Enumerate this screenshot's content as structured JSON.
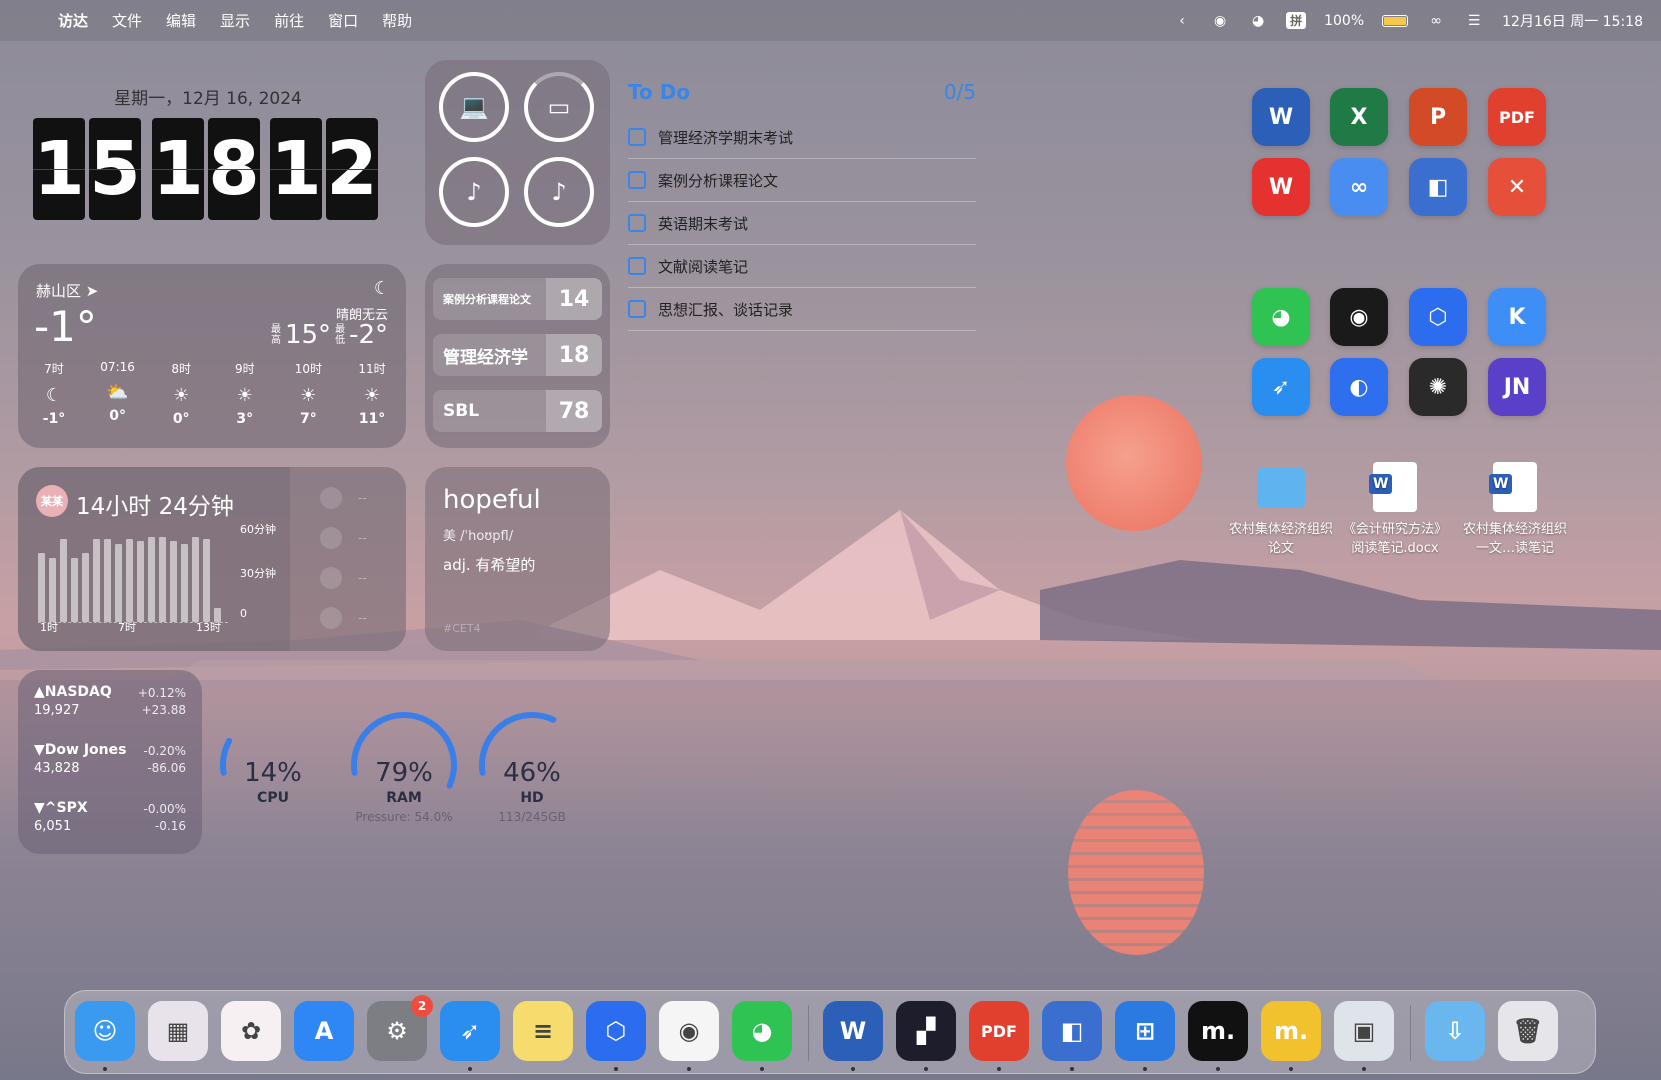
{
  "menubar": {
    "apple": "",
    "items": [
      "访达",
      "文件",
      "编辑",
      "显示",
      "前往",
      "窗口",
      "帮助"
    ],
    "status": {
      "ime": "拼",
      "battery": "100%",
      "datetime": "12月16日 周一 15:18"
    }
  },
  "clock": {
    "date": "星期一，12月 16, 2024",
    "digits": [
      "1",
      "5",
      "1",
      "8",
      "1",
      "2"
    ]
  },
  "weather": {
    "location": "赫山区",
    "temp": "-1°",
    "condition": "晴朗无云",
    "high_label": "最高",
    "high": "15°",
    "low_label": "最低",
    "low": "-2°",
    "hours": [
      {
        "time": "7时",
        "icon": "moon-icon",
        "glyph": "☾",
        "temp": "-1°"
      },
      {
        "time": "07:16",
        "icon": "sunrise-icon",
        "glyph": "⛅",
        "temp": "0°"
      },
      {
        "time": "8时",
        "icon": "sun-icon",
        "glyph": "☀",
        "temp": "0°"
      },
      {
        "time": "9时",
        "icon": "sun-icon",
        "glyph": "☀",
        "temp": "3°"
      },
      {
        "time": "10时",
        "icon": "sun-icon",
        "glyph": "☀",
        "temp": "7°"
      },
      {
        "time": "11时",
        "icon": "sun-icon",
        "glyph": "☀",
        "temp": "11°"
      }
    ]
  },
  "countdown": {
    "items": [
      {
        "name": "案例分析课程论文",
        "days": "14"
      },
      {
        "name": "管理经济学",
        "days": "18"
      },
      {
        "name": "SBL",
        "days": "78"
      }
    ]
  },
  "todo": {
    "title": "To Do",
    "count": "0/5",
    "items": [
      "管理经济学期末考试",
      "案例分析课程论文",
      "英语期末考试",
      "文献阅读笔记",
      "思想汇报、谈话记录"
    ]
  },
  "screentime": {
    "avatar": "某某",
    "total": "14小时 24分钟",
    "y_labels": [
      "60分钟",
      "30分钟",
      "0"
    ],
    "x_labels": [
      "1时",
      "7时",
      "13时"
    ],
    "bars": [
      0.75,
      0.7,
      0.9,
      0.7,
      0.75,
      0.9,
      0.9,
      0.85,
      0.9,
      0.88,
      0.92,
      0.92,
      0.88,
      0.85,
      0.92,
      0.9,
      0.15
    ],
    "right_dashes": [
      "--",
      "--",
      "--",
      "--"
    ]
  },
  "dictionary": {
    "word": "hopeful",
    "phonetic": "美  /ˈhoʊpfl/",
    "definition": "adj. 有希望的",
    "tag": "#CET4"
  },
  "stocks": [
    {
      "name": "▲NASDAQ",
      "price": "19,927",
      "pct": "+0.12%",
      "chg": "+23.88"
    },
    {
      "name": "▼Dow Jones",
      "price": "43,828",
      "pct": "-0.20%",
      "chg": "-86.06"
    },
    {
      "name": "▼^SPX",
      "price": "6,051",
      "pct": "-0.00%",
      "chg": "-0.16"
    }
  ],
  "system": {
    "cpu": {
      "value": "14%",
      "label": "CPU",
      "fraction": 0.14
    },
    "ram": {
      "value": "79%",
      "label": "RAM",
      "sub": "Pressure: 54.0%",
      "fraction": 0.79
    },
    "hd": {
      "value": "46%",
      "label": "HD",
      "sub": "113/245GB",
      "fraction": 0.46
    }
  },
  "desktop": {
    "docs": [
      {
        "icon": "folder-icon",
        "label": "农村集体经济组织论文"
      },
      {
        "icon": "word-doc-icon",
        "label": "《会计研究方法》阅读笔记.docx"
      },
      {
        "icon": "word-doc-icon",
        "label": "农村集体经济组织一文…读笔记"
      }
    ],
    "apps": [
      {
        "name": "word-icon",
        "glyph": "W",
        "color": "#2b5fb8"
      },
      {
        "name": "excel-icon",
        "glyph": "X",
        "color": "#1f7a46"
      },
      {
        "name": "powerpoint-icon",
        "glyph": "P",
        "color": "#d24a26"
      },
      {
        "name": "pdf-expert-icon",
        "glyph": "PDF",
        "color": "#e2402f"
      },
      {
        "name": "wps-icon",
        "glyph": "W",
        "color": "#e6322f"
      },
      {
        "name": "baidu-netdisk-icon",
        "glyph": "∞",
        "color": "#4a8df0"
      },
      {
        "name": "parallels-icon",
        "glyph": "◧",
        "color": "#3a6fd0"
      },
      {
        "name": "xmind-icon",
        "glyph": "✕",
        "color": "#e6503a"
      },
      {
        "name": "wechat-icon",
        "glyph": "◕",
        "color": "#2ec352"
      },
      {
        "name": "qq-icon",
        "glyph": "◉",
        "color": "#1a1a1a"
      },
      {
        "name": "lark-icon",
        "glyph": "⬡",
        "color": "#2c6df0"
      },
      {
        "name": "keynote-k-icon",
        "glyph": "K",
        "color": "#3d8ef6"
      },
      {
        "name": "safari-icon",
        "glyph": "➶",
        "color": "#2a8ef0"
      },
      {
        "name": "quark-icon",
        "glyph": "◐",
        "color": "#2e6ff0"
      },
      {
        "name": "chatgpt-icon",
        "glyph": "✺",
        "color": "#2a2a2a"
      },
      {
        "name": "jn-icon",
        "glyph": "JN",
        "color": "#5a3fc8"
      }
    ]
  },
  "dock": {
    "apps": [
      {
        "name": "finder-icon",
        "glyph": "☺",
        "color": "#3a9af0",
        "running": true
      },
      {
        "name": "launchpad-icon",
        "glyph": "▦",
        "color": "#e8e3ea",
        "running": false
      },
      {
        "name": "photos-icon",
        "glyph": "✿",
        "color": "#f6f0f2",
        "running": false
      },
      {
        "name": "app-store-icon",
        "glyph": "A",
        "color": "#2f86f5",
        "running": false
      },
      {
        "name": "system-settings-icon",
        "glyph": "⚙",
        "color": "#7d7d84",
        "running": false,
        "badge": "2"
      },
      {
        "name": "safari-icon",
        "glyph": "➶",
        "color": "#2a8ef0",
        "running": true
      },
      {
        "name": "notes-icon",
        "glyph": "≡",
        "color": "#f6dc6d",
        "running": false
      },
      {
        "name": "lark-icon",
        "glyph": "⬡",
        "color": "#2c6df0",
        "running": true
      },
      {
        "name": "qq-icon",
        "glyph": "◉",
        "color": "#f5f5f5",
        "running": true
      },
      {
        "name": "wechat-icon",
        "glyph": "◕",
        "color": "#2ec352",
        "running": true
      },
      {
        "name": "word-icon",
        "glyph": "W",
        "color": "#2b5fb8",
        "running": true
      },
      {
        "name": "setapp-icon",
        "glyph": "▞",
        "color": "#1d1d2b",
        "running": true
      },
      {
        "name": "pdf-expert-icon",
        "glyph": "PDF",
        "color": "#e2402f",
        "running": true
      },
      {
        "name": "parallels-icon",
        "glyph": "◧",
        "color": "#3a6fd0",
        "running": true
      },
      {
        "name": "windows-icon",
        "glyph": "⊞",
        "color": "#2a7ae2",
        "running": true
      },
      {
        "name": "marginnote-icon",
        "glyph": "m.",
        "color": "#111111",
        "running": true
      },
      {
        "name": "marginnote-huawei-icon",
        "glyph": "m.",
        "color": "#f2c12e",
        "running": true
      },
      {
        "name": "preview-icon",
        "glyph": "▣",
        "color": "#dfe4ea",
        "running": true
      },
      {
        "name": "downloads-folder-icon",
        "glyph": "⇩",
        "color": "#6ab7ef",
        "running": false
      },
      {
        "name": "trash-icon",
        "glyph": "🗑",
        "color": "#e6e6ea",
        "running": false
      }
    ]
  }
}
